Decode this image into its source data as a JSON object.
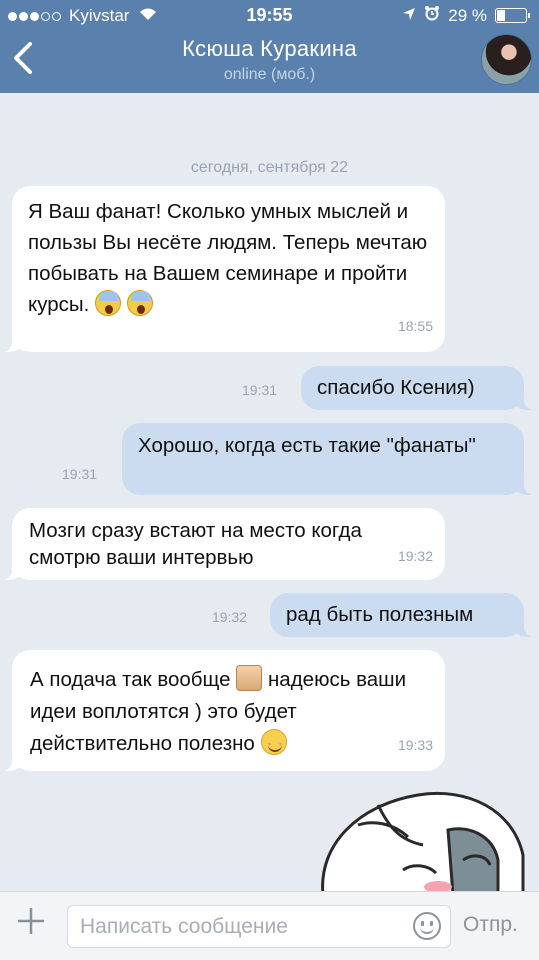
{
  "status_bar": {
    "carrier": "Kyivstar",
    "time": "19:55",
    "battery": "29 %",
    "battery_level": 0.29,
    "icons": [
      "wifi-icon",
      "location-icon",
      "alarm-icon",
      "battery-icon"
    ]
  },
  "header": {
    "back_icon": "chevron-left-icon",
    "title": "Ксюша Куракина",
    "subtitle": "online (моб.)"
  },
  "chat": {
    "date_separator": "сегодня, сентября 22",
    "messages": [
      {
        "direction": "in",
        "text": "Я Ваш фанат! Сколько умных мыслей и пользы Вы несёте людям. Теперь мечтаю побывать на Вашем семинаре и пройти курсы.",
        "emoji": [
          "scream-icon",
          "scream-icon"
        ],
        "time": "18:55"
      },
      {
        "direction": "out",
        "text": "спасибо Ксения)",
        "time": "19:31"
      },
      {
        "direction": "out",
        "text": "Хорошо, когда есть такие \"фанаты\"",
        "time": "19:31"
      },
      {
        "direction": "in",
        "text": "Мозги сразу встают на место когда смотрю ваши интервью",
        "time": "19:32"
      },
      {
        "direction": "out",
        "text": "рад быть полезным",
        "time": "19:32"
      },
      {
        "direction": "in",
        "text_before_emoji": "А подача так вообще",
        "text_after_emoji": "надеюсь ваши идеи воплотятся ) это будет действительно полезно",
        "emoji": [
          "thumbs-up-icon",
          "smile-icon"
        ],
        "time": "19:33"
      }
    ],
    "sticker": "crying-bunny-sticker"
  },
  "input_bar": {
    "attach_icon": "plus-icon",
    "placeholder": "Написать сообщение",
    "value": "",
    "emoji_icon": "smiley-icon",
    "send_label": "Отпр."
  },
  "colors": {
    "header": "#5a80ad",
    "background": "#e6ebf2",
    "incoming_bubble": "#ffffff",
    "outgoing_bubble": "#ccdcf0"
  }
}
